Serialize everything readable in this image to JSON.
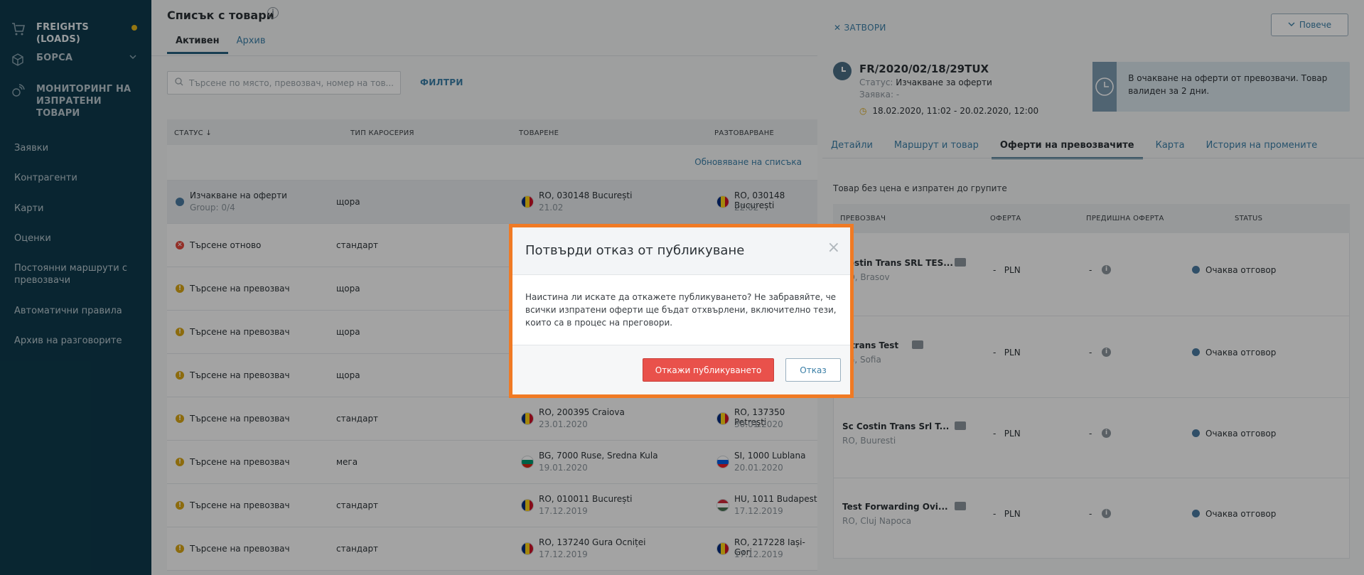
{
  "sidebar": {
    "top_items": [
      {
        "label": "FREIGHTS (LOADS)",
        "icon": "cart-icon"
      },
      {
        "label": "БОРСА",
        "icon": "box-icon"
      },
      {
        "label": "МОНИТОРИНГ НА ИЗПРАТЕНИ ТОВАРИ",
        "icon": "satellite-icon"
      }
    ],
    "sub_items": [
      "Заявки",
      "Контрагенти",
      "Карти",
      "Оценки",
      "Постоянни маршрути с превозвачи",
      "Автоматични правила",
      "Архив на разговорите"
    ]
  },
  "main": {
    "title": "Списък с товари",
    "tabs": [
      "Активен",
      "Архив"
    ],
    "search_placeholder": "Търсене по място, превозвач, номер на тов...",
    "filters_label": "ФИЛТРИ",
    "columns": [
      "СТАТУС ↓",
      "ТИП КАРОСЕРИЯ",
      "ТОВАРЕНЕ",
      "РАЗТОВАРВАНЕ"
    ],
    "refresh_label": "Обновяване на списъка",
    "rows": [
      {
        "status": "Изчакване на оферти",
        "group": "Group: 0/4",
        "kind": "wait",
        "body": "щора",
        "load": "RO, 030148 București",
        "load_date": "21.02",
        "unload": "RO, 030148 București",
        "unload_date": "22.02",
        "lflag": "ro",
        "uflag": "ro"
      },
      {
        "status": "Търсене отново",
        "kind": "err",
        "body": "стандарт"
      },
      {
        "status": "Търсене на превозвач",
        "kind": "warn",
        "body": "щора"
      },
      {
        "status": "Търсене на превозвач",
        "kind": "warn",
        "body": "щора"
      },
      {
        "status": "Търсене на превозвач",
        "kind": "warn",
        "body": "щора"
      },
      {
        "status": "Търсене на превозвач",
        "kind": "warn",
        "body": "стандарт",
        "load": "RO, 200395 Craiova",
        "load_date": "23.01.2020",
        "unload": "RO, 137350 Petreşti",
        "unload_date": "30.01.2020",
        "lflag": "ro",
        "uflag": "ro"
      },
      {
        "status": "Търсене на превозвач",
        "kind": "warn",
        "body": "мега",
        "load": "BG, 7000 Ruse, Sredna Kula",
        "load_date": "19.01.2020",
        "unload": "SI, 1000 Lublana",
        "unload_date": "20.01.2020",
        "lflag": "bg",
        "uflag": "si"
      },
      {
        "status": "Търсене на превозвач",
        "kind": "warn",
        "body": "стандарт",
        "load": "RO, 010011 București",
        "load_date": "17.12.2019",
        "unload": "HU, 1011 Budapest",
        "unload_date": "17.12.2019",
        "lflag": "ro",
        "uflag": "hu"
      },
      {
        "status": "Търсене на превозвач",
        "kind": "warn",
        "body": "стандарт",
        "load": "RO, 137240 Gura Ocniței",
        "load_date": "17.12.2019",
        "unload": "RO, 217228 Iași-Gorj",
        "unload_date": "17.12.2019",
        "lflag": "ro",
        "uflag": "ro"
      }
    ]
  },
  "panel": {
    "close_label": "ЗАТВОРИ",
    "more_label": "Повече",
    "freight_id": "FR/2020/02/18/29TUX",
    "status_label": "Статус:",
    "status_value": "Изчакване за оферти",
    "order_label": "Заявка:",
    "order_value": "-",
    "date_range": "18.02.2020, 11:02 - 20.02.2020, 12:00",
    "alert_text": "В очакване на оферти от превозвачи. Товар валиден за 2 дни.",
    "tabs": [
      "Детайли",
      "Маршрут и товар",
      "Оферти на превозвачите",
      "Карта",
      "История на промените"
    ],
    "active_tab": 2,
    "info": "Товар без цена е изпратен до групите",
    "columns": [
      "ПРЕВОЗВАЧ",
      "ОФЕРТА",
      "ПРЕДИШНА ОФЕРТА",
      "STATUS"
    ],
    "offers": [
      {
        "name": "Costin Trans SRL TES...",
        "city": "RO, Brasov",
        "dash": "-",
        "currency": "PLN",
        "prev": "-",
        "status": "Очаква отговор"
      },
      {
        "name": "Mtrans Test",
        "city": "BG, Sofia",
        "dash": "-",
        "currency": "PLN",
        "prev": "-",
        "status": "Очаква отговор"
      },
      {
        "name": "Sc Costin Trans Srl T...",
        "city": "RO, Buuresti",
        "dash": "-",
        "currency": "PLN",
        "prev": "-",
        "status": "Очаква отговор"
      },
      {
        "name": "Test Forwarding Ovi...",
        "city": "RO, Cluj Napoca",
        "dash": "-",
        "currency": "PLN",
        "prev": "-",
        "status": "Очаква отговор"
      }
    ]
  },
  "modal": {
    "title": "Потвърди отказ от публикуване",
    "body": "Наистина ли искате да откажете публикуването? Не забравяйте, че всички изпратени оферти ще бъдат отхвърлени, включително тези, които са в процес на преговори.",
    "confirm_label": "Откажи публикуването",
    "cancel_label": "Отказ"
  },
  "colors": {
    "sidebar": "#0e3a4c",
    "accent": "#3b7fa7",
    "danger": "#e9514b",
    "highlight": "#f07a24",
    "warning": "#d7a514"
  }
}
